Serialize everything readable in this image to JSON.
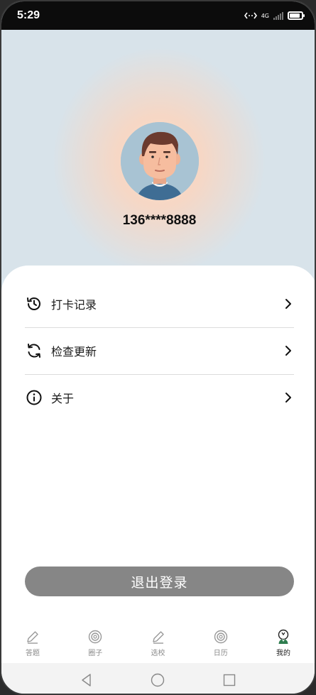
{
  "status_bar": {
    "time": "5:29",
    "network": "4G"
  },
  "profile": {
    "phone": "136****8888"
  },
  "menu": [
    {
      "label": "打卡记录",
      "icon": "history-icon"
    },
    {
      "label": "检查更新",
      "icon": "refresh-icon"
    },
    {
      "label": "关于",
      "icon": "info-icon"
    }
  ],
  "logout_label": "退出登录",
  "tabs": [
    {
      "label": "答题",
      "icon": "pencil-icon",
      "active": false
    },
    {
      "label": "圈子",
      "icon": "circle-target-icon",
      "active": false
    },
    {
      "label": "选校",
      "icon": "pencil-icon",
      "active": false
    },
    {
      "label": "日历",
      "icon": "circle-target-icon",
      "active": false
    },
    {
      "label": "我的",
      "icon": "user-avatar-icon",
      "active": true
    }
  ],
  "colors": {
    "accent_button": "#868686",
    "hero_glow": "#ffdcc5",
    "hero_bg": "#d8e3ea"
  }
}
